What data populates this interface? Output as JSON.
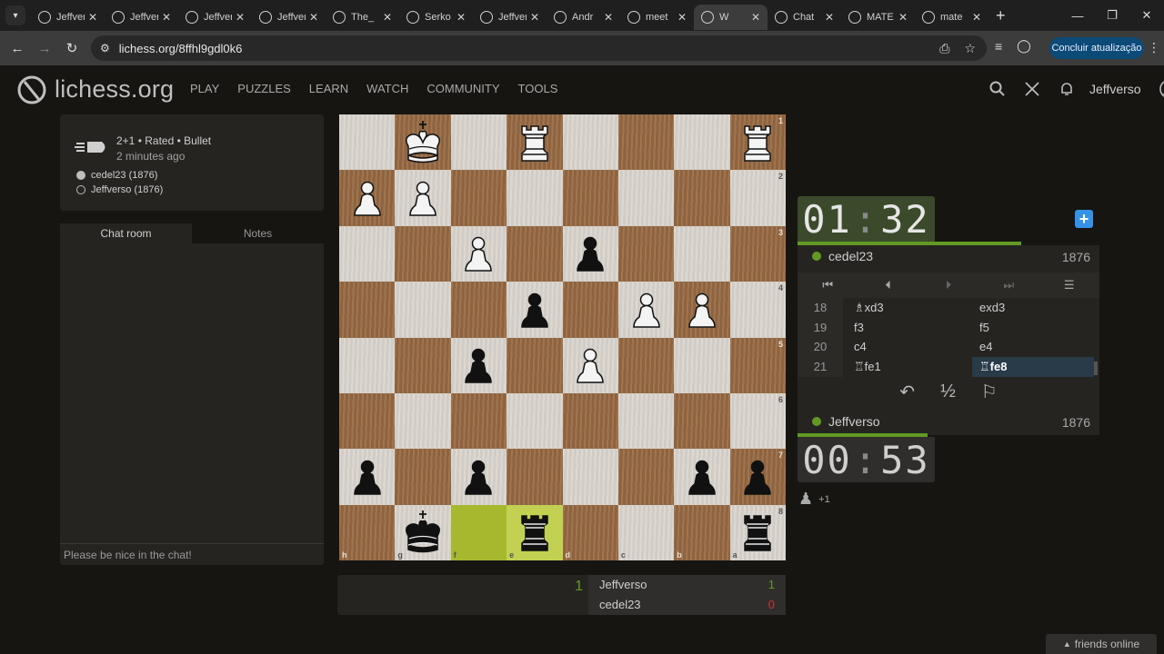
{
  "browser": {
    "tabs": [
      {
        "title": "Jeffverso",
        "active": false
      },
      {
        "title": "Jeffverso",
        "active": false
      },
      {
        "title": "Jeffverso",
        "active": false
      },
      {
        "title": "Jeffverso",
        "active": false
      },
      {
        "title": "The_",
        "active": false
      },
      {
        "title": "Serko",
        "active": false
      },
      {
        "title": "Jeffverso",
        "active": false
      },
      {
        "title": "Andr",
        "active": false
      },
      {
        "title": "meet",
        "active": false
      },
      {
        "title": "W",
        "active": true
      },
      {
        "title": "Chat",
        "active": false
      },
      {
        "title": "MATE",
        "active": false
      },
      {
        "title": "mate",
        "active": false
      }
    ],
    "url": "lichess.org/8ffhl9gdl0k6",
    "update_button": "Concluir atualização"
  },
  "site": {
    "logo_text": "lichess.org",
    "nav": [
      "PLAY",
      "PUZZLES",
      "LEARN",
      "WATCH",
      "COMMUNITY",
      "TOOLS"
    ],
    "username": "Jeffverso"
  },
  "game_info": {
    "line1": "2+1 • Rated • Bullet",
    "line2": "2 minutes ago",
    "white_player": "cedel23 (1876)",
    "black_player": "Jeffverso (1876)"
  },
  "chat": {
    "tab_chat": "Chat room",
    "tab_notes": "Notes",
    "placeholder": "Please be nice in the chat!"
  },
  "board": {
    "ranks": [
      [
        "",
        "wK",
        "",
        "wR",
        "",
        "",
        "",
        "wR"
      ],
      [
        "wP",
        "wP",
        "",
        "",
        "",
        "",
        "",
        ""
      ],
      [
        "",
        "",
        "wP",
        "",
        "bP",
        "",
        "",
        ""
      ],
      [
        "",
        "",
        "",
        "bP",
        "",
        "wP",
        "wP",
        ""
      ],
      [
        "",
        "",
        "bP",
        "",
        "wP",
        "",
        "",
        ""
      ],
      [
        "",
        "",
        "",
        "",
        "",
        "",
        "",
        ""
      ],
      [
        "bP",
        "",
        "bP",
        "",
        "",
        "",
        "bP",
        "bP"
      ],
      [
        "",
        "bK",
        "",
        "bR",
        "",
        "",
        "",
        "bR"
      ]
    ],
    "rank_labels": [
      "1",
      "2",
      "3",
      "4",
      "5",
      "6",
      "7",
      "8"
    ],
    "file_labels": [
      "h",
      "g",
      "f",
      "e",
      "d",
      "c",
      "b",
      "a"
    ]
  },
  "right": {
    "clock_top": {
      "min": "01",
      "sec": "32"
    },
    "clock_bottom": {
      "min": "00",
      "sec": "53"
    },
    "top_player": "cedel23",
    "top_rating": "1876",
    "bottom_player": "Jeffverso",
    "bottom_rating": "1876",
    "moves": [
      {
        "num": "18",
        "white": "♗xd3",
        "black": "exd3"
      },
      {
        "num": "19",
        "white": "f3",
        "black": "f5"
      },
      {
        "num": "20",
        "white": "c4",
        "black": "e4"
      },
      {
        "num": "21",
        "white": "♖fe1",
        "black": "♖fe8"
      }
    ],
    "draw_label": "½",
    "bonus": "+1"
  },
  "score": {
    "left_num": "1",
    "rows": [
      {
        "name": "Jeffverso",
        "value": "1",
        "color": "#629924"
      },
      {
        "name": "cedel23",
        "value": "0",
        "color": "#cc3333"
      }
    ]
  },
  "friends": "friends online",
  "colors": {
    "accent_green": "#629924",
    "brand_blue": "#3692e7"
  }
}
